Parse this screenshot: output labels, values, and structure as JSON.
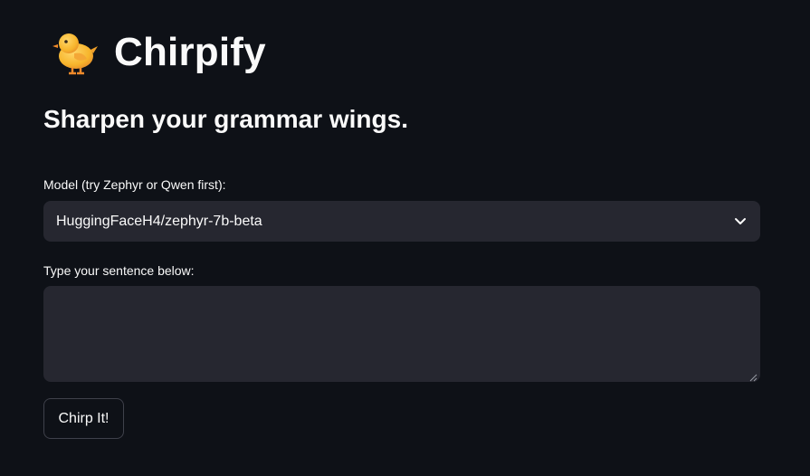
{
  "header": {
    "title": "Chirpify",
    "logo_icon": "baby-chick-icon"
  },
  "subtitle": "Sharpen your grammar wings.",
  "model_select": {
    "label": "Model (try Zephyr or Qwen first):",
    "selected_value": "HuggingFaceH4/zephyr-7b-beta",
    "icon": "chevron-down-icon"
  },
  "sentence_input": {
    "label": "Type your sentence below:",
    "value": "",
    "placeholder": ""
  },
  "submit_button": {
    "label": "Chirp It!"
  },
  "colors": {
    "background": "#0e1117",
    "input_background": "#262730",
    "text": "#fafafa",
    "button_border": "#3f414b"
  }
}
